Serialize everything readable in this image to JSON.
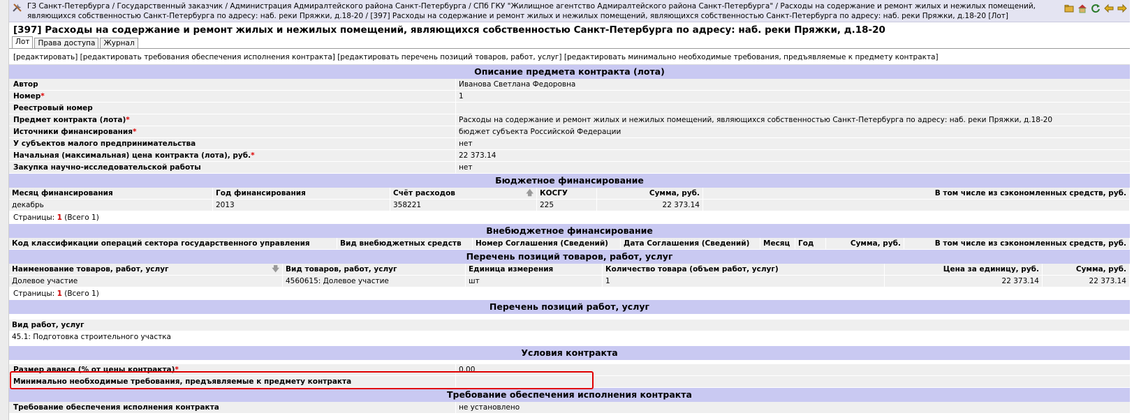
{
  "breadcrumb": "ГЗ Санкт-Петербурга / Государственный заказчик / Администрация Адмиралтейского района Санкт-Петербурга / СПб ГКУ \"Жилищное агентство Адмиралтейского района Санкт-Петербурга\" / Расходы на содержание и ремонт жилых и нежилых помещений, являющихся собственностью Санкт-Петербурга по адресу: наб. реки Пряжки, д.18-20 / [397] Расходы на содержание и ремонт жилых и нежилых помещений, являющихся собственностью Санкт-Петербурга по адресу: наб. реки Пряжки, д.18-20 [Лот]",
  "page_title": "[397] Расходы на содержание и ремонт жилых и нежилых помещений, являющихся собственностью Санкт-Петербурга по адресу: наб. реки Пряжки, д.18-20",
  "tabs": [
    "Лот",
    "Права доступа",
    "Журнал"
  ],
  "actions": "[редактировать] [редактировать требования обеспечения исполнения контракта] [редактировать перечень позиций товаров, работ, услуг] [редактировать минимально необходимые требования, предъявляемые к предмету контракта]",
  "description": {
    "header": "Описание предмета контракта (лота)",
    "rows": [
      {
        "label": "Автор",
        "required": "",
        "value": "Иванова Светлана Федоровна"
      },
      {
        "label": "Номер",
        "required": "*",
        "value": "1"
      },
      {
        "label": "Реестровый номер",
        "required": "",
        "value": ""
      },
      {
        "label": "Предмет контракта (лота)",
        "required": "*",
        "value": "Расходы на содержание и ремонт жилых и нежилых помещений, являющихся собственностью Санкт-Петербурга по адресу: наб. реки Пряжки, д.18-20"
      },
      {
        "label": "Источники финансирования",
        "required": "*",
        "value": "бюджет субъекта Российской Федерации"
      },
      {
        "label": "У субъектов малого предпринимательства",
        "required": "",
        "value": "нет"
      },
      {
        "label": "Начальная (максимальная) цена контракта (лота), руб.",
        "required": "*",
        "value": "22 373.14"
      },
      {
        "label": "Закупка научно-исследовательской работы",
        "required": "",
        "value": "нет"
      }
    ]
  },
  "budget": {
    "header": "Бюджетное финансирование",
    "columns": [
      "Месяц финансирования",
      "Год финансирования",
      "Счёт расходов",
      "КОСГУ",
      "Сумма, руб.",
      "В том числе из сэкономленных средств, руб."
    ],
    "row": [
      "декабрь",
      "2013",
      "358221",
      "225",
      "22 373.14",
      ""
    ],
    "pages_label": "Страницы:",
    "pages_num": "1",
    "pages_total": "(Всего 1)"
  },
  "offbudget": {
    "header": "Внебюджетное финансирование",
    "columns": [
      "Код классификации операций сектора государственного управления",
      "Вид внебюджетных средств",
      "Номер Соглашения (Сведений)",
      "Дата Соглашения (Сведений)",
      "Месяц",
      "Год",
      "Сумма, руб.",
      "В том числе из сэкономленных средств, руб."
    ]
  },
  "goods": {
    "header": "Перечень позиций товаров, работ, услуг",
    "columns": [
      "Наименование товаров, работ, услуг",
      "Вид товаров, работ, услуг",
      "Единица измерения",
      "Количество товара (объем работ, услуг)",
      "Цена за единицу, руб.",
      "Сумма, руб."
    ],
    "row": [
      "Долевое участие",
      "4560615: Долевое участие",
      "шт",
      "1",
      "22 373.14",
      "22 373.14"
    ],
    "pages_label": "Страницы:",
    "pages_num": "1",
    "pages_total": "(Всего 1)"
  },
  "works": {
    "header": "Перечень позиций работ, услуг",
    "column": "Вид работ, услуг",
    "value": "45.1: Подготовка строительного участка"
  },
  "conditions": {
    "header": "Условия контракта",
    "advance_label": "Размер аванса (% от цены контракта)",
    "advance_required": "*",
    "advance_value": "0.00",
    "min_req_label": "Минимально необходимые требования, предъявляемые к предмету контракта",
    "min_req_value": ""
  },
  "security": {
    "header": "Требование обеспечения исполнения контракта",
    "label": "Требование обеспечения исполнения контракта",
    "value": "не установлено"
  },
  "colors": {
    "section_header": "#c9c9f2",
    "row_bg": "#efefef",
    "highlight": "#e00000",
    "required": "#dd0000"
  }
}
